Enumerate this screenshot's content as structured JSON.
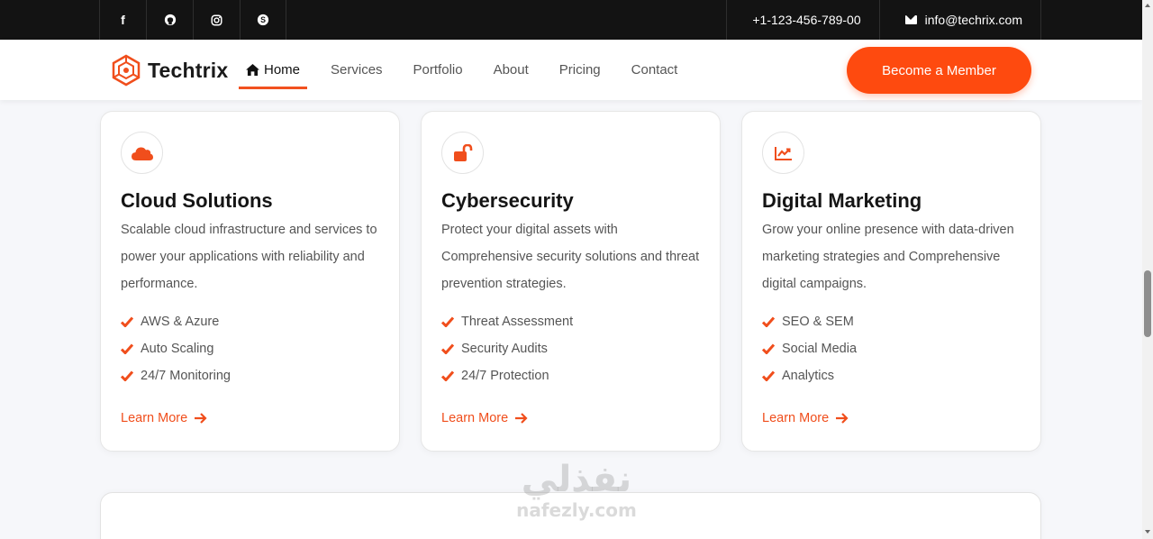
{
  "topbar": {
    "social": [
      {
        "icon": "facebook-icon",
        "glyph": "f"
      },
      {
        "icon": "github-icon",
        "glyph": "◉"
      },
      {
        "icon": "instagram-icon",
        "glyph": "◎"
      },
      {
        "icon": "skype-icon",
        "glyph": "S"
      }
    ],
    "phone": "+1-123-456-789-00",
    "email": "info@techrix.com"
  },
  "navbar": {
    "brand": "Techtrix",
    "items": [
      {
        "label": "Home",
        "active": true
      },
      {
        "label": "Services"
      },
      {
        "label": "Portfolio"
      },
      {
        "label": "About"
      },
      {
        "label": "Pricing"
      },
      {
        "label": "Contact"
      }
    ],
    "cta_label": "Become a Member"
  },
  "cards": [
    {
      "icon": "cloud-icon",
      "title": "Cloud Solutions",
      "description": "Scalable cloud infrastructure and services to power your applications with reliability and performance.",
      "features": [
        "AWS & Azure",
        "Auto Scaling",
        "24/7 Monitoring"
      ],
      "link_label": "Learn More"
    },
    {
      "icon": "unlock-icon",
      "title": "Cybersecurity",
      "description": "Protect your digital assets with Comprehensive security solutions and threat prevention strategies.",
      "features": [
        "Threat Assessment",
        "Security Audits",
        "24/7 Protection"
      ],
      "link_label": "Learn More"
    },
    {
      "icon": "chart-line-icon",
      "title": "Digital Marketing",
      "description": "Grow your online presence with data-driven marketing strategies and Comprehensive digital campaigns.",
      "features": [
        "SEO & SEM",
        "Social Media",
        "Analytics"
      ],
      "link_label": "Learn More"
    }
  ],
  "watermark": {
    "arabic": "نفذلي",
    "latin": "nafezly.com"
  },
  "colors": {
    "accent": "#fe4a0f",
    "topbar": "#131313",
    "background": "#f6f7fa"
  }
}
